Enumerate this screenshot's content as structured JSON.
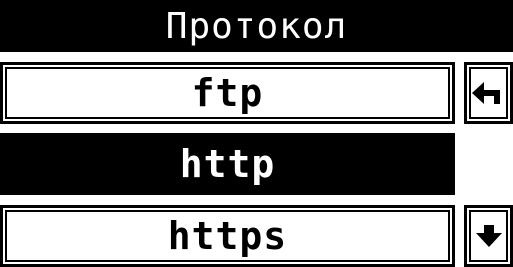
{
  "header": {
    "title": "Протокол"
  },
  "options": [
    {
      "label": "ftp",
      "selected": false
    },
    {
      "label": "http",
      "selected": true
    },
    {
      "label": "https",
      "selected": false
    }
  ],
  "controls": {
    "back_icon": "back-arrow-icon",
    "down_icon": "down-arrow-icon"
  },
  "colors": {
    "foreground": "#000000",
    "background": "#ffffff"
  }
}
